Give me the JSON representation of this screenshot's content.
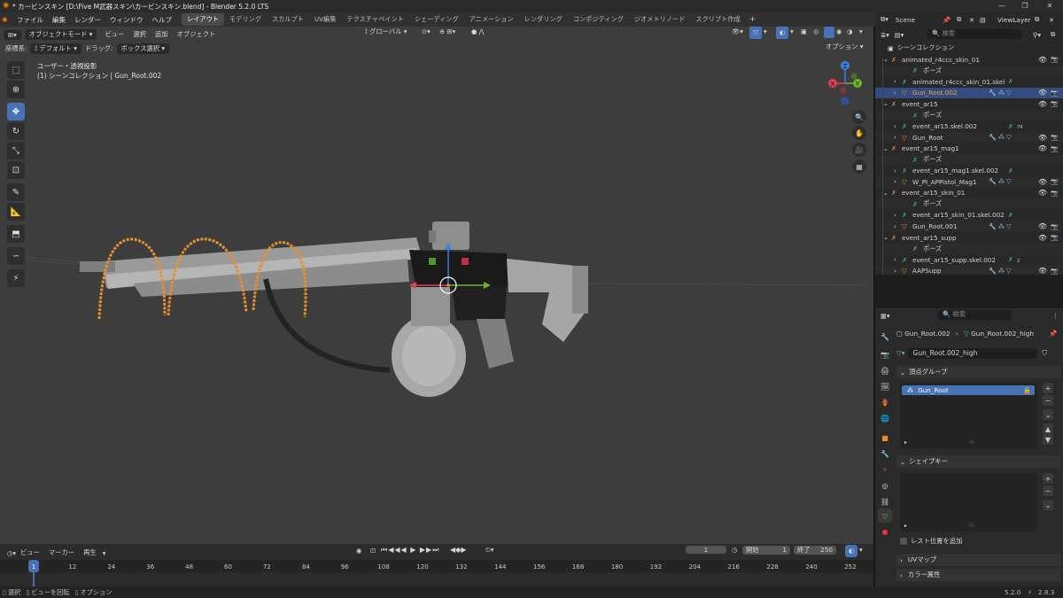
{
  "titlebar": {
    "title": "* カービンスキン [D:\\Five M武器スキン\\カービンスキン.blend] - Blender 5.2.0 LTS"
  },
  "menus": [
    "ファイル",
    "編集",
    "レンダー",
    "ウィンドウ",
    "ヘルプ"
  ],
  "workspaces": [
    "レイアウト",
    "モデリング",
    "スカルプト",
    "UV編集",
    "テクスチャペイント",
    "シェーディング",
    "アニメーション",
    "レンダリング",
    "コンポジティング",
    "ジオメトリノード",
    "スクリプト作成"
  ],
  "scene": {
    "name": "Scene",
    "view_layer": "ViewLayer"
  },
  "viewport": {
    "mode": "オブジェクトモード",
    "menus": [
      "ビュー",
      "選択",
      "追加",
      "オブジェクト"
    ],
    "transform": "グローバル",
    "options": "オプション",
    "orientation_label": "座標系:",
    "orientation_value": "デフォルト",
    "drag_label": "ドラッグ:",
    "drag_value": "ボックス選択",
    "view_name": "ユーザー・透視投影",
    "view_info": "(1) シーンコレクション | Gun_Root.002",
    "gizmo": {
      "x": "X",
      "y": "Y",
      "z": "Z"
    }
  },
  "timeline": {
    "menus": [
      "ビュー",
      "マーカー",
      "再生"
    ],
    "current_frame": "1",
    "start_label": "開始",
    "start": "1",
    "end_label": "終了",
    "end": "250",
    "ticks": [
      "1",
      "12",
      "24",
      "36",
      "48",
      "60",
      "72",
      "84",
      "96",
      "108",
      "120",
      "132",
      "144",
      "156",
      "168",
      "180",
      "192",
      "204",
      "216",
      "228",
      "240",
      "252"
    ]
  },
  "statusbar": {
    "select": "選択",
    "rotate": "ビューを回転",
    "options": "オプション",
    "version": "5.2.0",
    "addon_version": "2.8.3"
  },
  "outliner": {
    "search_placeholder": "検索",
    "root": "シーンコレクション",
    "items": [
      {
        "label": "animated_r4ccc_skin_01",
        "indent": 0,
        "icon": "armature"
      },
      {
        "label": "ポーズ",
        "indent": 2,
        "icon": "pose"
      },
      {
        "label": "animated_r4ccc_skin_01.skel",
        "indent": 1,
        "icon": "armature-data"
      },
      {
        "label": "Gun_Root.002",
        "indent": 1,
        "icon": "mesh",
        "selected": true
      },
      {
        "label": "event_ar15",
        "indent": 0,
        "icon": "armature"
      },
      {
        "label": "ポーズ",
        "indent": 2,
        "icon": "pose"
      },
      {
        "label": "event_ar15.skel.002",
        "indent": 1,
        "icon": "armature-data",
        "badge": "74"
      },
      {
        "label": "Gun_Root",
        "indent": 1,
        "icon": "mesh"
      },
      {
        "label": "event_ar15_mag1",
        "indent": 0,
        "icon": "armature"
      },
      {
        "label": "ポーズ",
        "indent": 2,
        "icon": "pose"
      },
      {
        "label": "event_ar15_mag1.skel.002",
        "indent": 1,
        "icon": "armature-data"
      },
      {
        "label": "W_PI_APPistol_Mag1",
        "indent": 1,
        "icon": "mesh"
      },
      {
        "label": "event_ar15_skin_01",
        "indent": 0,
        "icon": "armature"
      },
      {
        "label": "ポーズ",
        "indent": 2,
        "icon": "pose"
      },
      {
        "label": "event_ar15_skin_01.skel.002",
        "indent": 1,
        "icon": "armature-data"
      },
      {
        "label": "Gun_Root.001",
        "indent": 1,
        "icon": "mesh"
      },
      {
        "label": "event_ar15_supp",
        "indent": 0,
        "icon": "armature"
      },
      {
        "label": "ポーズ",
        "indent": 2,
        "icon": "pose"
      },
      {
        "label": "event_ar15_supp.skel.002",
        "indent": 1,
        "icon": "armature-data",
        "badge": "2"
      },
      {
        "label": "AAPSupp",
        "indent": 1,
        "icon": "mesh"
      }
    ]
  },
  "properties": {
    "search_placeholder": "検索",
    "breadcrumb_object": "Gun_Root.002",
    "breadcrumb_data": "Gun_Root.002_high",
    "data_name": "Gun_Root.002_high",
    "vertex_groups_title": "頂点グループ",
    "vertex_group_item": "Gun_Root",
    "shape_keys_title": "シェイプキー",
    "relative_label": "レスト位置を追加",
    "uv_maps_title": "UVマップ",
    "color_attr_title": "カラー属性"
  },
  "colors": {
    "accent": "#4772b3",
    "selection": "#334d80",
    "origin_orange": "#e8902a"
  }
}
